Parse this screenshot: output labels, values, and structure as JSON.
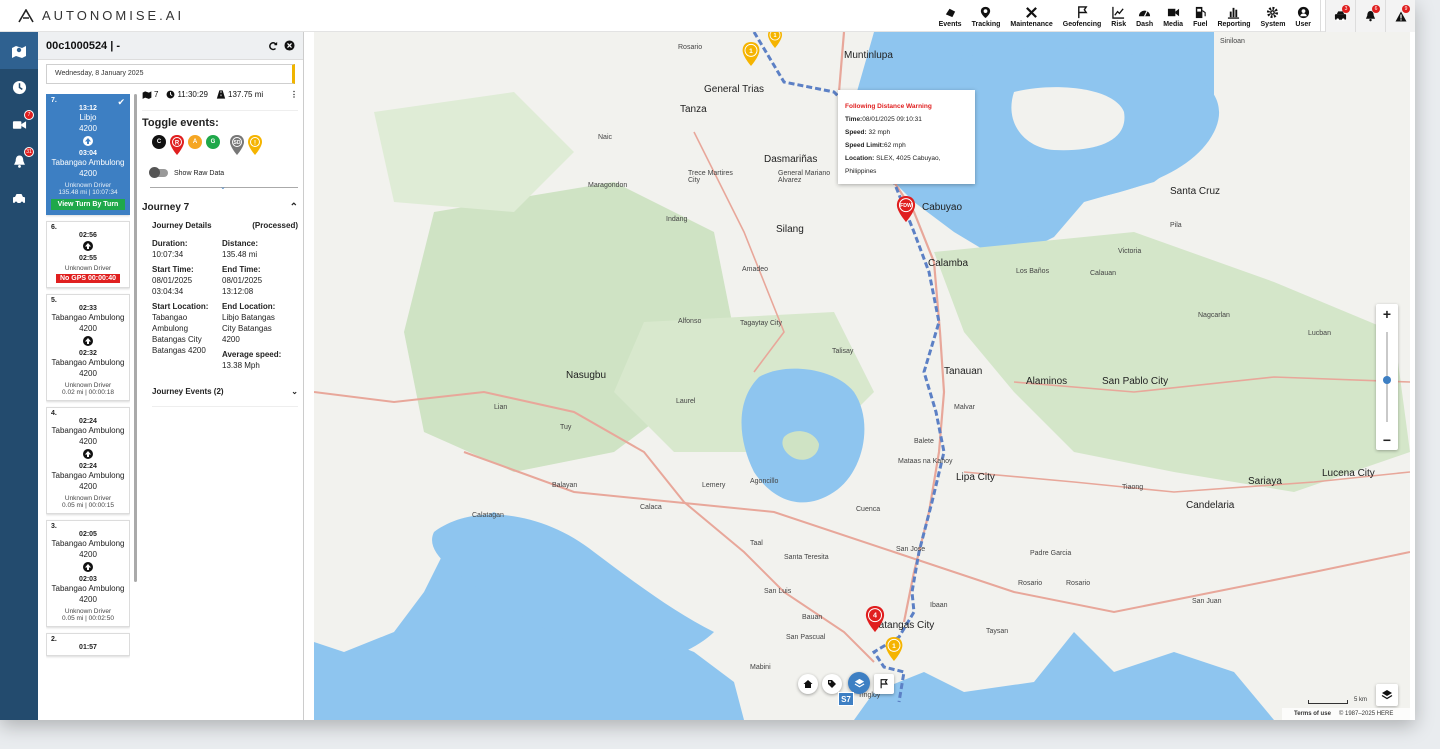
{
  "brand": {
    "name": "AUTONOMISE.AI"
  },
  "nav": {
    "items": [
      {
        "label": "Events",
        "icon": "events-icon"
      },
      {
        "label": "Tracking",
        "icon": "location-pin-icon"
      },
      {
        "label": "Maintenance",
        "icon": "tools-icon"
      },
      {
        "label": "Geofencing",
        "icon": "geofence-flag-icon"
      },
      {
        "label": "Risk",
        "icon": "chart-line-icon"
      },
      {
        "label": "Dash",
        "icon": "dashboard-gauge-icon"
      },
      {
        "label": "Media",
        "icon": "video-camera-icon"
      },
      {
        "label": "Fuel",
        "icon": "fuel-pump-icon"
      },
      {
        "label": "Reporting",
        "icon": "bar-chart-icon"
      },
      {
        "label": "System",
        "icon": "gear-icon"
      },
      {
        "label": "User",
        "icon": "user-icon"
      }
    ],
    "alerts": [
      {
        "icon": "vehicle-alert-icon",
        "badge": "3"
      },
      {
        "icon": "bell-icon",
        "badge": "6"
      },
      {
        "icon": "warning-icon",
        "badge": "9"
      }
    ]
  },
  "sidenav": {
    "items": [
      {
        "icon": "map-icon",
        "badge": ""
      },
      {
        "icon": "clock-icon",
        "badge": ""
      },
      {
        "icon": "video-icon",
        "badge": "7"
      },
      {
        "icon": "bell-icon",
        "badge": "31"
      },
      {
        "icon": "car-icon",
        "badge": ""
      }
    ]
  },
  "panel": {
    "title": "00c1000524 | -",
    "date": "Wednesday, 8 January 2025"
  },
  "journeys": [
    {
      "num": "7.",
      "start_time": "13:12",
      "start_loc": "Libjo",
      "start_code": "4200",
      "end_time": "03:04",
      "end_loc": "Tabangao Ambulong",
      "end_code": "4200",
      "driver": "Unknown Driver",
      "meta": "135.48 mi | 10:07:34",
      "action": "View Turn By Turn",
      "selected": true
    },
    {
      "num": "6.",
      "start_time": "02:56",
      "start_loc": "",
      "start_code": "",
      "end_time": "02:55",
      "end_loc": "",
      "end_code": "",
      "driver": "Unknown Driver",
      "meta": "",
      "warning": "No GPS 00:00:40"
    },
    {
      "num": "5.",
      "start_time": "02:33",
      "start_loc": "Tabangao Ambulong",
      "start_code": "4200",
      "end_time": "02:32",
      "end_loc": "Tabangao Ambulong",
      "end_code": "4200",
      "driver": "Unknown Driver",
      "meta": "0.02 mi | 00:00:18"
    },
    {
      "num": "4.",
      "start_time": "02:24",
      "start_loc": "Tabangao Ambulong",
      "start_code": "4200",
      "end_time": "02:24",
      "end_loc": "Tabangao Ambulong",
      "end_code": "4200",
      "driver": "Unknown Driver",
      "meta": "0.05 mi | 00:00:15"
    },
    {
      "num": "3.",
      "start_time": "02:05",
      "start_loc": "Tabangao Ambulong",
      "start_code": "4200",
      "end_time": "02:03",
      "end_loc": "Tabangao Ambulong",
      "end_code": "4200",
      "driver": "Unknown Driver",
      "meta": "0.05 mi | 00:02:50"
    },
    {
      "num": "2.",
      "start_time": "01:57",
      "start_loc": "",
      "start_code": "",
      "end_time": "",
      "end_loc": "",
      "end_code": "",
      "driver": "",
      "meta": ""
    }
  ],
  "details": {
    "journey_count": "7",
    "duration_short": "11:30:29",
    "distance_short": "137.75 mi",
    "toggle_title": "Toggle events:",
    "chips": [
      {
        "label": "C",
        "color": "#111111"
      },
      {
        "label": "R",
        "color": "#e01f1f"
      },
      {
        "label": "A",
        "color": "#f5a623"
      },
      {
        "label": "G",
        "color": "#1fa84a"
      },
      {
        "label": "SD",
        "color": "#777777"
      },
      {
        "label": "!",
        "color": "#f5b400"
      }
    ],
    "show_raw": "Show Raw Data",
    "journey_title": "Journey 7",
    "section_title": "Journey Details",
    "status": "(Processed)",
    "duration_label": "Duration:",
    "duration": "10:07:34",
    "distance_label": "Distance:",
    "distance": "135.48 mi",
    "start_time_label": "Start Time:",
    "start_time": "08/01/2025 03:04:34",
    "end_time_label": "End Time:",
    "end_time": "08/01/2025 13:12:08",
    "start_loc_label": "Start Location:",
    "start_loc": "Tabangao Ambulong Batangas City Batangas 4200",
    "end_loc_label": "End Location:",
    "end_loc": "Libjo Batangas City Batangas 4200",
    "avg_speed_label": "Average speed:",
    "avg_speed": "13.38 Mph",
    "events_title": "Journey Events (2)"
  },
  "popup": {
    "title": "Following Distance Warning",
    "time_label": "Time:",
    "time": "08/01/2025 09:10:31",
    "speed_label": "Speed:",
    "speed": "32 mph",
    "limit_label": "Speed Limit:",
    "limit": "62 mph",
    "location_label": "Location:",
    "location": "SLEX, 4025 Cabuyao, Philippines"
  },
  "map_labels": [
    {
      "text": "Muntinlupa",
      "big": true
    },
    {
      "text": "General Trias",
      "big": true
    },
    {
      "text": "Dasmariñas",
      "big": true
    },
    {
      "text": "Tanza",
      "big": true
    },
    {
      "text": "Cabuyao",
      "big": true
    },
    {
      "text": "Calamba",
      "big": true
    },
    {
      "text": "Santa Cruz",
      "big": true
    },
    {
      "text": "Silang",
      "big": true
    },
    {
      "text": "Nasugbu",
      "big": true
    },
    {
      "text": "Tanauan",
      "big": true
    },
    {
      "text": "Lipa City",
      "big": true
    },
    {
      "text": "Batangas City",
      "big": true
    },
    {
      "text": "San Pablo City",
      "big": true
    },
    {
      "text": "Lucena City",
      "big": true
    },
    {
      "text": "Candelaria",
      "big": true
    },
    {
      "text": "Sariaya",
      "big": true
    },
    {
      "text": "Alaminos",
      "big": true
    },
    {
      "text": "Tagaytay City",
      "big": false
    },
    {
      "text": "Talisay",
      "big": false
    },
    {
      "text": "Lemery",
      "big": false
    },
    {
      "text": "Calaca",
      "big": false
    },
    {
      "text": "Balayan",
      "big": false
    },
    {
      "text": "Taal",
      "big": false
    },
    {
      "text": "Calatagan",
      "big": false
    },
    {
      "text": "Mabini",
      "big": false
    },
    {
      "text": "Bauan",
      "big": false
    },
    {
      "text": "San Pascual",
      "big": false
    },
    {
      "text": "Rosario",
      "big": false
    },
    {
      "text": "Taysan",
      "big": false
    },
    {
      "text": "Padre Garcia",
      "big": false
    },
    {
      "text": "San Juan",
      "big": false
    },
    {
      "text": "Tiaong",
      "big": false
    },
    {
      "text": "Nagcarlan",
      "big": false
    },
    {
      "text": "Lucban",
      "big": false
    },
    {
      "text": "Victoria",
      "big": false
    },
    {
      "text": "Los Baños",
      "big": false
    },
    {
      "text": "Calauan",
      "big": false
    },
    {
      "text": "Pila",
      "big": false
    },
    {
      "text": "Malvar",
      "big": false
    },
    {
      "text": "Alfonso",
      "big": false
    },
    {
      "text": "Amadeo",
      "big": false
    },
    {
      "text": "Indang",
      "big": false
    },
    {
      "text": "Naic",
      "big": false
    },
    {
      "text": "Maragondon",
      "big": false
    },
    {
      "text": "Laurel",
      "big": false
    },
    {
      "text": "Agoncillo",
      "big": false
    },
    {
      "text": "Tuy",
      "big": false
    },
    {
      "text": "Lian",
      "big": false
    },
    {
      "text": "Ibaan",
      "big": false
    },
    {
      "text": "San Jose",
      "big": false
    },
    {
      "text": "Rosario",
      "big": false
    },
    {
      "text": "Cuenca",
      "big": false
    },
    {
      "text": "Trece Martires City",
      "big": false
    },
    {
      "text": "General Mariano Alvarez",
      "big": false
    },
    {
      "text": "Balete",
      "big": false
    },
    {
      "text": "Mataas na Kahoy",
      "big": false
    },
    {
      "text": "Santa Teresita",
      "big": false
    },
    {
      "text": "San Luis",
      "big": false
    },
    {
      "text": "Tingloy",
      "big": false
    },
    {
      "text": "Siniloan",
      "big": false
    },
    {
      "text": "Rosario",
      "big": false
    }
  ],
  "map_footer": {
    "terms": "Terms of use",
    "copyright": "© 1987–2025 HERE",
    "scale": "5 km"
  },
  "markers": [
    {
      "label": "FDW",
      "color": "#e01f1f"
    },
    {
      "label": "4",
      "color": "#e01f1f"
    },
    {
      "label": "1",
      "color": "#f5b400"
    },
    {
      "label": "1",
      "color": "#f5b400"
    },
    {
      "label": "1",
      "color": "#f5b400"
    }
  ],
  "route_shields": [
    "S7"
  ]
}
